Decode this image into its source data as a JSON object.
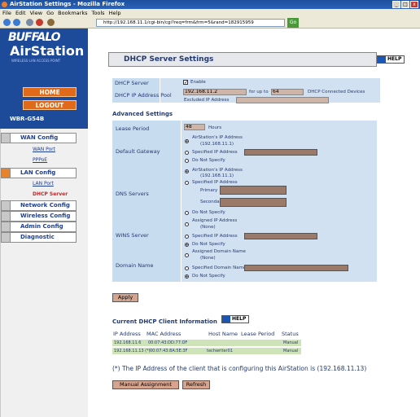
{
  "window": {
    "title": "AirStation Settings - Mozilla Firefox",
    "min": "_",
    "max": "□",
    "close": "x"
  },
  "menu": {
    "items": "File Edit View Go Bookmarks Tools Help"
  },
  "address": {
    "url": "http://192.168.11.1/cgi-bin/cgi?req=frm&frm=5&rand=182915959",
    "go": "Go"
  },
  "brand": {
    "logo": "BUFFALO",
    "product": "AirStation",
    "tagline": "WIRELESS LAN ACCESS POINT",
    "model": "WBR-G54B"
  },
  "nav": {
    "home": "HOME",
    "logout": "LOGOUT",
    "wan": "WAN Config",
    "wanport": "WAN Port",
    "pppoe": "PPPoE",
    "lan": "LAN Config",
    "lanport": "LAN Port",
    "dhcpserver": "DHCP Server",
    "network": "Network Config",
    "wireless": "Wireless Config",
    "admin": "Admin Config",
    "diag": "Diagnostic"
  },
  "page": {
    "title": "DHCP Server Settings",
    "help": "HELP"
  },
  "dhcp": {
    "server_label": "DHCP Server",
    "enable": "Enable",
    "pool_label": "DHCP IP Address Pool",
    "pool_start": "192.168.11.2",
    "for_up_to": "for up to",
    "pool_count": "64",
    "connected": "DHCP Connected Devices",
    "excluded": "Excluded IP Address"
  },
  "advanced": {
    "title": "Advanced Settings",
    "lease_label": "Lease Period",
    "lease_value": "48",
    "hours": "Hours",
    "gw_label": "Default Gateway",
    "gw_opt1": "AirStation's IP Address",
    "gw_opt1_ip": "(192.168.11.1)",
    "gw_opt2": "Specified IP Address",
    "gw_opt3": "Do Not Specify",
    "dns_label": "DNS Servers",
    "dns_opt1": "AirStation's IP Address",
    "dns_opt1_ip": "(192.168.11.1)",
    "dns_opt2": "Specified IP Address",
    "dns_primary": "Primary",
    "dns_secondary": "Secondary",
    "dns_opt3": "Do Not Specify",
    "wins_label": "WINS Server",
    "wins_opt1": "Assigned IP Address",
    "wins_opt1_sub": "(None)",
    "wins_opt2": "Specified IP Address",
    "wins_opt3": "Do Not Specify",
    "domain_label": "Domain Name",
    "dom_opt1": "Assigned Domain Name",
    "dom_opt1_sub": "(None)",
    "dom_opt2": "Specified Domain Name",
    "dom_opt3": "Do Not Specify"
  },
  "apply": "Apply",
  "clients": {
    "title": "Current DHCP Client Information",
    "help": "HELP",
    "headers": [
      "IP Address",
      "MAC Address",
      "Host Name",
      "Lease Period",
      "Status"
    ],
    "rows": [
      [
        "192.168.11.6",
        "00:07:43:DD:77:DF",
        "",
        "",
        "Manual"
      ],
      [
        "192.168.11.13 (*)",
        "00:07:43:8A:5E:3F",
        "techwriter01",
        "",
        "Manual"
      ]
    ],
    "note": "(*) The IP Address of the client that is configuring this AirStation is (192.168.11.13)",
    "manual_btn": "Manual Assignment",
    "refresh_btn": "Refresh"
  },
  "colors": {
    "sidebar": "#1e4a9a",
    "accent": "#e06a1a",
    "table": "#c8dcf0",
    "input": "#cfb5a8"
  }
}
